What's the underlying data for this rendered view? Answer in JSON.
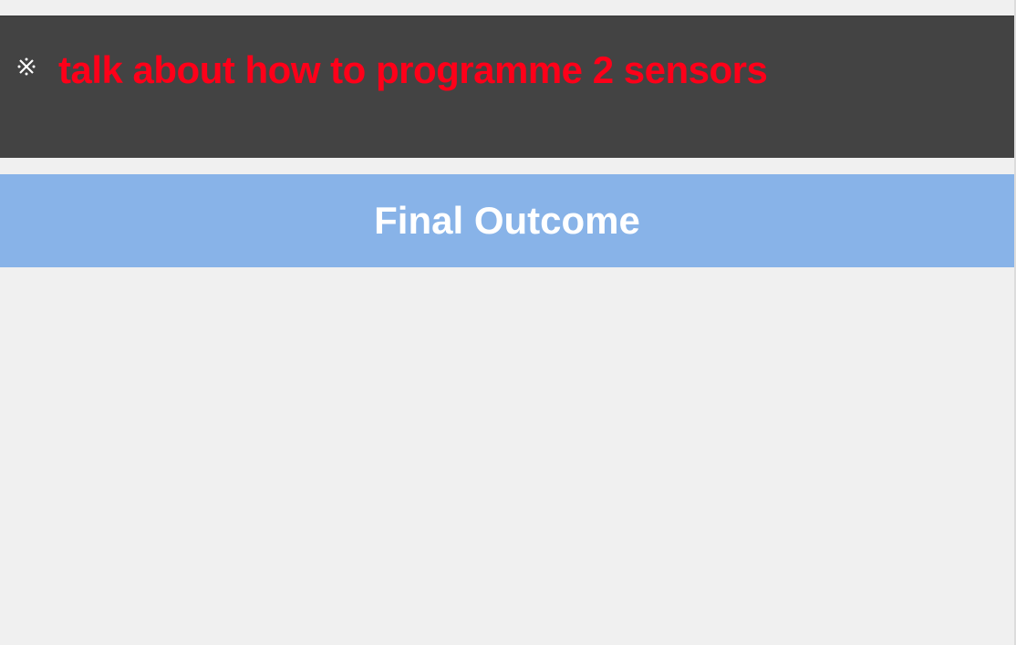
{
  "header": {
    "title": "talk about how to programme 2 sensors",
    "icon": "close-icon",
    "title_color": "#ff0019",
    "background": "#434343"
  },
  "banner": {
    "label": "Final Outcome",
    "background": "#88b3e8"
  }
}
